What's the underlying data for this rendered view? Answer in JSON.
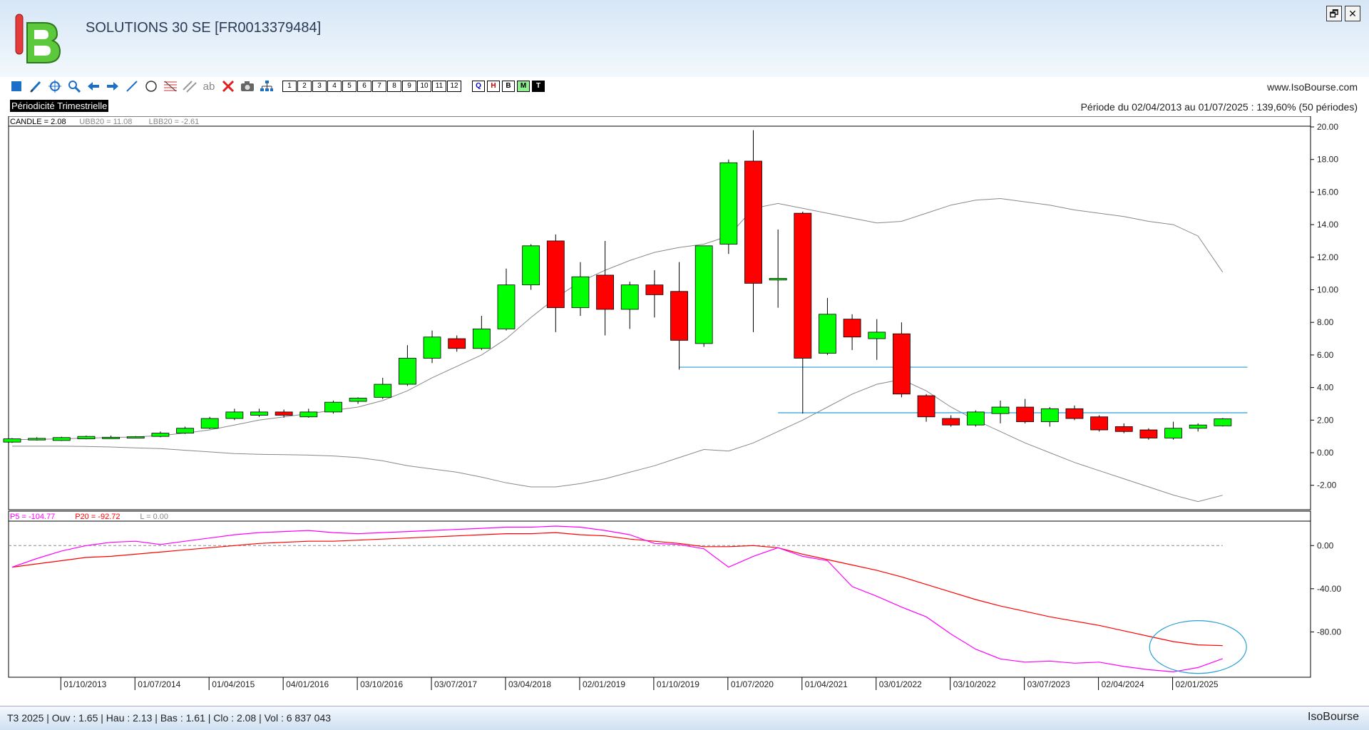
{
  "window": {
    "title": "SOLUTIONS 30 SE [FR0013379484]",
    "restore_label": "🗗",
    "close_label": "✕"
  },
  "toolbar": {
    "tools": [
      "square-icon",
      "pencil-icon",
      "crosshair-icon",
      "zoom-icon",
      "arrow-left-icon",
      "arrow-right-icon",
      "line-icon",
      "circle-icon",
      "fibonacci-icon",
      "channel-icon",
      "text-icon",
      "delete-icon",
      "camera-icon",
      "tree-icon"
    ],
    "text_tool_label": "ab",
    "numbers": [
      "1",
      "2",
      "3",
      "4",
      "5",
      "6",
      "7",
      "8",
      "9",
      "10",
      "11",
      "12"
    ],
    "periods": [
      {
        "label": "Q",
        "color": "#0000cc",
        "bg": "#ffffff"
      },
      {
        "label": "H",
        "color": "#cc0000",
        "bg": "#ffffff"
      },
      {
        "label": "B",
        "color": "#000000",
        "bg": "#ffffff"
      },
      {
        "label": "M",
        "color": "#000000",
        "bg": "#90ee90"
      },
      {
        "label": "T",
        "color": "#ffffff",
        "bg": "#000000"
      }
    ]
  },
  "header": {
    "website": "www.IsoBourse.com",
    "periodicity": "Périodicité Trimestrielle",
    "period_range": "Période du 02/04/2013 au 01/07/2025 : 139,60% (50 périodes)"
  },
  "status": {
    "text": "T3 2025 | Ouv : 1.65 | Hau : 2.13 | Bas : 1.61 | Clo : 2.08 | Vol : 6 837 043",
    "brand": "IsoBourse"
  },
  "colors": {
    "up": "#00ff00",
    "down": "#ff0000",
    "bollinger": "#888888",
    "hline": "#2a9fd6",
    "p5": "#ff00ff",
    "p20": "#ff0000",
    "circle": "#2a9fd6"
  },
  "chart_data": [
    {
      "type": "candlestick",
      "legend": [
        {
          "label": "CANDLE = 2.08",
          "color": "#000000"
        },
        {
          "label": "UBB20 = 11.08",
          "color": "#888888"
        },
        {
          "label": "LBB20 = -2.61",
          "color": "#888888"
        }
      ],
      "ylim": [
        -3.5,
        20
      ],
      "yticks": [
        "20.00",
        "18.00",
        "16.00",
        "14.00",
        "12.00",
        "10.00",
        "8.00",
        "6.00",
        "4.00",
        "2.00",
        "0.00",
        "-2.00"
      ],
      "ytick_values": [
        20,
        18,
        16,
        14,
        12,
        10,
        8,
        6,
        4,
        2,
        0,
        -2
      ],
      "xtick_labels": [
        "01/10/2013",
        "01/07/2014",
        "01/04/2015",
        "04/01/2016",
        "03/10/2016",
        "03/07/2017",
        "03/04/2018",
        "02/01/2019",
        "01/10/2019",
        "01/07/2020",
        "01/04/2021",
        "03/01/2022",
        "03/10/2022",
        "03/07/2023",
        "02/04/2024",
        "02/01/2025"
      ],
      "candles": [
        {
          "o": 0.65,
          "h": 0.9,
          "l": 0.6,
          "c": 0.85
        },
        {
          "o": 0.78,
          "h": 0.95,
          "l": 0.75,
          "c": 0.88
        },
        {
          "o": 0.75,
          "h": 0.98,
          "l": 0.72,
          "c": 0.93
        },
        {
          "o": 0.85,
          "h": 1.05,
          "l": 0.82,
          "c": 1.0
        },
        {
          "o": 0.9,
          "h": 1.05,
          "l": 0.88,
          "c": 0.95
        },
        {
          "o": 0.92,
          "h": 1.02,
          "l": 0.88,
          "c": 0.98
        },
        {
          "o": 1.0,
          "h": 1.3,
          "l": 0.95,
          "c": 1.2
        },
        {
          "o": 1.2,
          "h": 1.6,
          "l": 1.15,
          "c": 1.5
        },
        {
          "o": 1.5,
          "h": 2.2,
          "l": 1.45,
          "c": 2.1
        },
        {
          "o": 2.1,
          "h": 2.7,
          "l": 2.0,
          "c": 2.5
        },
        {
          "o": 2.3,
          "h": 2.7,
          "l": 2.2,
          "c": 2.5
        },
        {
          "o": 2.5,
          "h": 2.65,
          "l": 2.15,
          "c": 2.3
        },
        {
          "o": 2.2,
          "h": 2.7,
          "l": 2.15,
          "c": 2.5
        },
        {
          "o": 2.5,
          "h": 3.2,
          "l": 2.4,
          "c": 3.1
        },
        {
          "o": 3.15,
          "h": 3.4,
          "l": 3.0,
          "c": 3.35
        },
        {
          "o": 3.4,
          "h": 4.6,
          "l": 3.3,
          "c": 4.2
        },
        {
          "o": 4.2,
          "h": 6.6,
          "l": 4.1,
          "c": 5.8
        },
        {
          "o": 5.8,
          "h": 7.5,
          "l": 5.5,
          "c": 7.1
        },
        {
          "o": 7.0,
          "h": 7.2,
          "l": 6.2,
          "c": 6.4
        },
        {
          "o": 6.4,
          "h": 8.4,
          "l": 6.3,
          "c": 7.6
        },
        {
          "o": 7.6,
          "h": 11.3,
          "l": 7.5,
          "c": 10.3
        },
        {
          "o": 10.3,
          "h": 12.8,
          "l": 10.0,
          "c": 12.7
        },
        {
          "o": 13.0,
          "h": 13.4,
          "l": 7.4,
          "c": 8.9
        },
        {
          "o": 8.9,
          "h": 11.7,
          "l": 8.4,
          "c": 10.8
        },
        {
          "o": 10.9,
          "h": 13.0,
          "l": 7.2,
          "c": 8.8
        },
        {
          "o": 8.8,
          "h": 10.5,
          "l": 7.6,
          "c": 10.3
        },
        {
          "o": 10.3,
          "h": 11.2,
          "l": 8.3,
          "c": 9.7
        },
        {
          "o": 9.9,
          "h": 11.7,
          "l": 5.1,
          "c": 6.9
        },
        {
          "o": 6.7,
          "h": 12.7,
          "l": 6.5,
          "c": 12.7
        },
        {
          "o": 12.8,
          "h": 18.0,
          "l": 12.2,
          "c": 17.8
        },
        {
          "o": 17.9,
          "h": 19.8,
          "l": 7.4,
          "c": 10.4
        },
        {
          "o": 10.6,
          "h": 13.7,
          "l": 8.9,
          "c": 10.7
        },
        {
          "o": 14.7,
          "h": 14.8,
          "l": 2.4,
          "c": 5.8
        },
        {
          "o": 6.1,
          "h": 9.5,
          "l": 6.0,
          "c": 8.5
        },
        {
          "o": 8.2,
          "h": 8.5,
          "l": 6.3,
          "c": 7.1
        },
        {
          "o": 7.0,
          "h": 8.2,
          "l": 5.7,
          "c": 7.4
        },
        {
          "o": 7.3,
          "h": 8.0,
          "l": 3.4,
          "c": 3.6
        },
        {
          "o": 3.5,
          "h": 3.6,
          "l": 1.9,
          "c": 2.2
        },
        {
          "o": 2.1,
          "h": 2.3,
          "l": 1.6,
          "c": 1.7
        },
        {
          "o": 1.7,
          "h": 2.6,
          "l": 1.6,
          "c": 2.5
        },
        {
          "o": 2.4,
          "h": 3.2,
          "l": 1.8,
          "c": 2.8
        },
        {
          "o": 2.8,
          "h": 3.3,
          "l": 1.8,
          "c": 1.9
        },
        {
          "o": 1.9,
          "h": 2.8,
          "l": 1.6,
          "c": 2.7
        },
        {
          "o": 2.7,
          "h": 2.9,
          "l": 2.0,
          "c": 2.1
        },
        {
          "o": 2.2,
          "h": 2.3,
          "l": 1.3,
          "c": 1.4
        },
        {
          "o": 1.6,
          "h": 1.8,
          "l": 1.2,
          "c": 1.3
        },
        {
          "o": 1.4,
          "h": 1.5,
          "l": 0.8,
          "c": 0.9
        },
        {
          "o": 0.9,
          "h": 1.9,
          "l": 0.8,
          "c": 1.5
        },
        {
          "o": 1.5,
          "h": 1.8,
          "l": 1.3,
          "c": 1.7
        },
        {
          "o": 1.65,
          "h": 2.13,
          "l": 1.61,
          "c": 2.08
        }
      ],
      "ubb20": [
        0.8,
        0.82,
        0.85,
        0.9,
        0.93,
        0.97,
        1.05,
        1.2,
        1.4,
        1.7,
        2.0,
        2.2,
        2.4,
        2.6,
        2.8,
        3.2,
        3.8,
        4.6,
        5.3,
        6.0,
        7.0,
        8.3,
        9.5,
        10.5,
        11.2,
        11.8,
        12.3,
        12.6,
        12.8,
        13.3,
        15.0,
        15.3,
        15.0,
        14.7,
        14.4,
        14.1,
        14.2,
        14.7,
        15.2,
        15.5,
        15.6,
        15.4,
        15.2,
        14.9,
        14.7,
        14.5,
        14.2,
        14.0,
        13.3,
        11.08
      ],
      "lbb20": [
        0.4,
        0.4,
        0.4,
        0.38,
        0.35,
        0.3,
        0.25,
        0.15,
        0.05,
        -0.05,
        -0.1,
        -0.12,
        -0.15,
        -0.2,
        -0.3,
        -0.5,
        -0.8,
        -1.0,
        -1.2,
        -1.5,
        -1.85,
        -2.1,
        -2.1,
        -1.9,
        -1.6,
        -1.2,
        -0.8,
        -0.3,
        0.2,
        0.1,
        0.6,
        1.3,
        2.0,
        2.8,
        3.6,
        4.2,
        4.5,
        3.8,
        2.8,
        2.0,
        1.3,
        0.6,
        0.0,
        -0.6,
        -1.1,
        -1.6,
        -2.1,
        -2.6,
        -3.0,
        -2.61
      ],
      "hlines": [
        {
          "y": 5.25,
          "from": 27,
          "to": 50
        },
        {
          "y": 2.45,
          "from": 31,
          "to": 50
        }
      ]
    },
    {
      "type": "line",
      "legend": [
        {
          "label": "P5 = -104.77",
          "color": "#ff00ff"
        },
        {
          "label": "P20 = -92.72",
          "color": "#ff0000"
        },
        {
          "label": "L = 0.00",
          "color": "#888888"
        }
      ],
      "ylim": [
        -122,
        20
      ],
      "yticks": [
        "0.00",
        "-40.00",
        "-80.00"
      ],
      "ytick_values": [
        0,
        -40,
        -80
      ],
      "series": [
        {
          "name": "P5",
          "color": "#ff00ff",
          "values": [
            -20,
            -12,
            -5,
            0,
            3,
            4,
            1,
            4,
            7,
            10,
            12,
            13,
            14,
            12,
            11,
            12,
            13,
            14,
            15,
            16,
            17,
            17,
            18,
            17,
            14,
            10,
            2,
            1,
            -3,
            -20,
            -10,
            -2,
            -10,
            -14,
            -38,
            -47,
            -57,
            -66,
            -82,
            -96,
            -105,
            -108,
            -107,
            -109,
            -108,
            -112,
            -115,
            -117,
            -113,
            -104.77
          ]
        },
        {
          "name": "P20",
          "color": "#ff0000",
          "values": [
            -20,
            -17,
            -14,
            -11,
            -10,
            -8,
            -6,
            -4,
            -2,
            0,
            2,
            3,
            4,
            4,
            5,
            6,
            7,
            8,
            9,
            10,
            11,
            11,
            12,
            10,
            9,
            6,
            4,
            2,
            -1,
            -1,
            0,
            -2,
            -8,
            -13,
            -18,
            -23,
            -29,
            -36,
            -43,
            -50,
            -56,
            -61,
            -66,
            -70,
            -74,
            -79,
            -84,
            -89,
            -92,
            -92.72
          ]
        },
        {
          "name": "L",
          "color": "#888888",
          "values": [
            0,
            0
          ]
        }
      ]
    }
  ]
}
